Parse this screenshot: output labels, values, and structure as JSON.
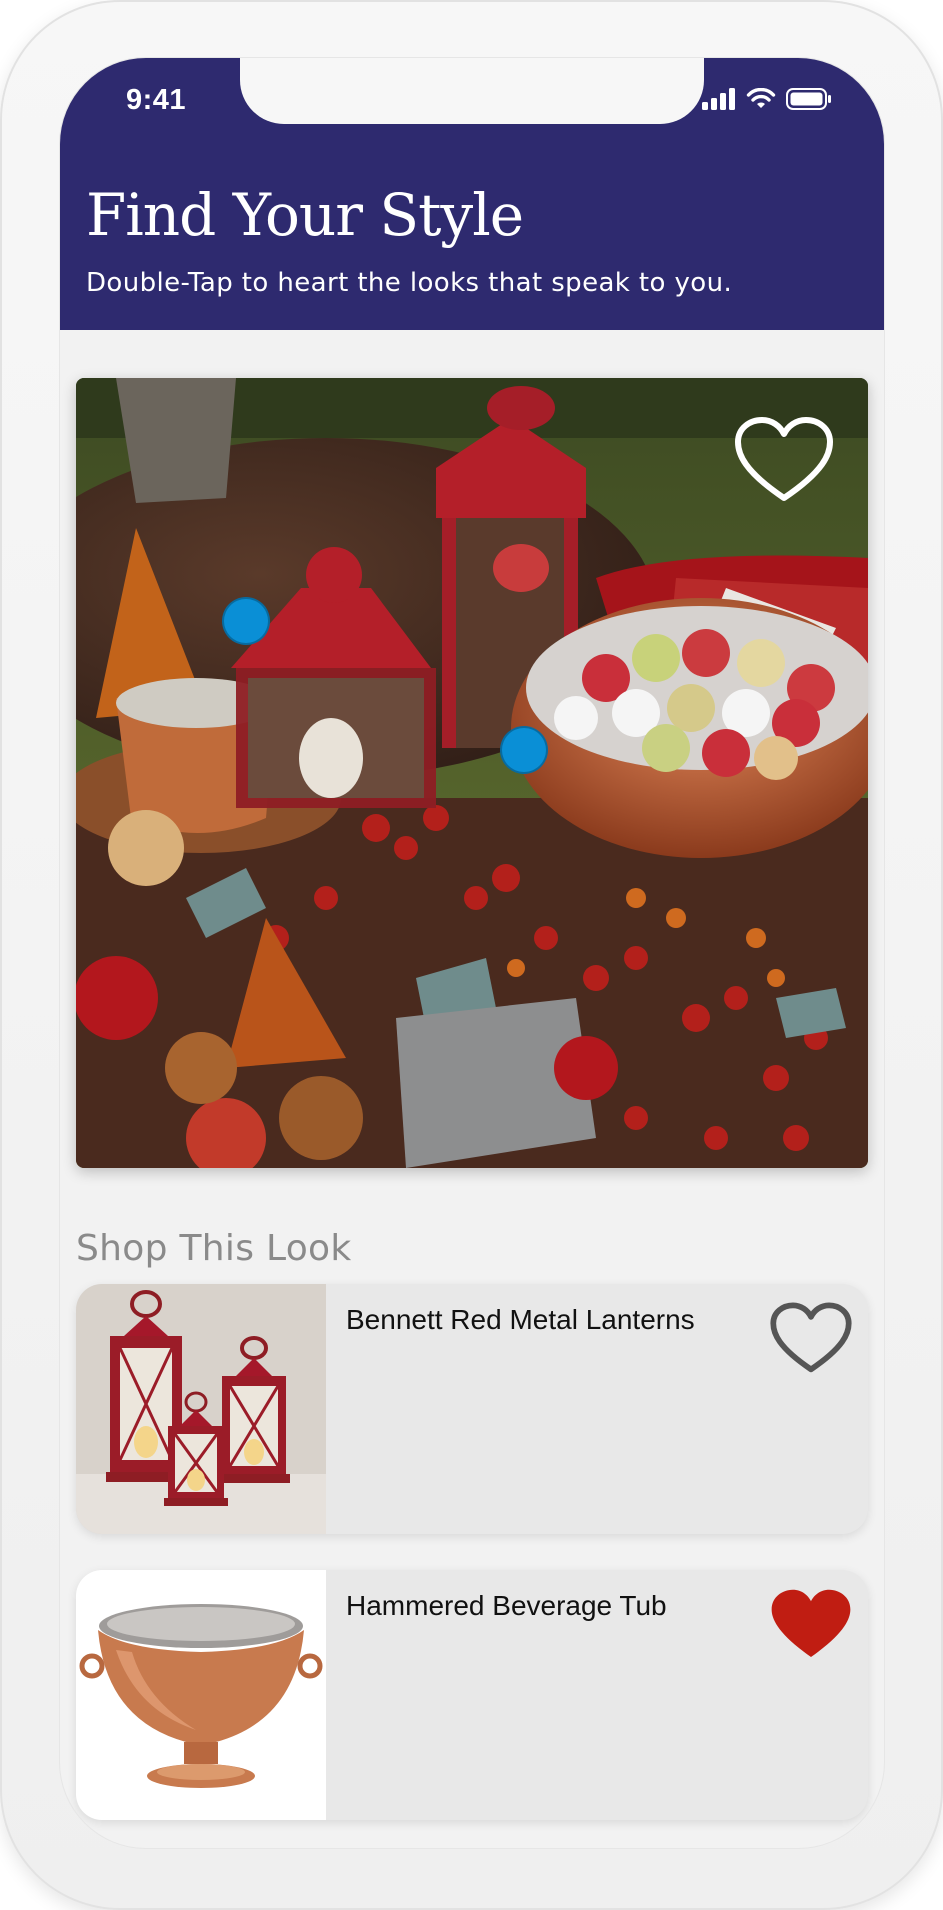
{
  "status_bar": {
    "time": "9:41",
    "icons": [
      "cellular-signal-icon",
      "wifi-icon",
      "battery-icon"
    ]
  },
  "header": {
    "title": "Find Your Style",
    "subtitle": "Double-Tap to heart the looks that speak to you.",
    "background": "#2e2a6f"
  },
  "look": {
    "image_description_icon": "autumn-lanterns-photo",
    "favorited": false,
    "hotspot_count": 2,
    "hotspot_color": "#0a8fd6"
  },
  "shop": {
    "section_title": "Shop This Look",
    "products": [
      {
        "name": "Bennett Red Metal Lanterns",
        "favorited": false,
        "thumb_icon": "red-lanterns-image"
      },
      {
        "name": "Hammered Beverage Tub",
        "favorited": true,
        "thumb_icon": "copper-tub-image"
      }
    ],
    "heart_active_color": "#c01d12",
    "heart_inactive_color": "#555555"
  }
}
